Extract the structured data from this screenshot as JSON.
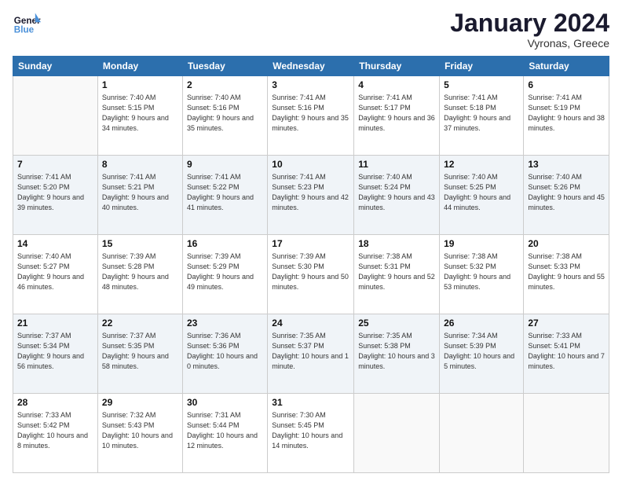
{
  "header": {
    "logo_line1": "General",
    "logo_line2": "Blue",
    "month": "January 2024",
    "location": "Vyronas, Greece"
  },
  "weekdays": [
    "Sunday",
    "Monday",
    "Tuesday",
    "Wednesday",
    "Thursday",
    "Friday",
    "Saturday"
  ],
  "weeks": [
    [
      {
        "day": "",
        "sunrise": "",
        "sunset": "",
        "daylight": ""
      },
      {
        "day": "1",
        "sunrise": "Sunrise: 7:40 AM",
        "sunset": "Sunset: 5:15 PM",
        "daylight": "Daylight: 9 hours and 34 minutes."
      },
      {
        "day": "2",
        "sunrise": "Sunrise: 7:40 AM",
        "sunset": "Sunset: 5:16 PM",
        "daylight": "Daylight: 9 hours and 35 minutes."
      },
      {
        "day": "3",
        "sunrise": "Sunrise: 7:41 AM",
        "sunset": "Sunset: 5:16 PM",
        "daylight": "Daylight: 9 hours and 35 minutes."
      },
      {
        "day": "4",
        "sunrise": "Sunrise: 7:41 AM",
        "sunset": "Sunset: 5:17 PM",
        "daylight": "Daylight: 9 hours and 36 minutes."
      },
      {
        "day": "5",
        "sunrise": "Sunrise: 7:41 AM",
        "sunset": "Sunset: 5:18 PM",
        "daylight": "Daylight: 9 hours and 37 minutes."
      },
      {
        "day": "6",
        "sunrise": "Sunrise: 7:41 AM",
        "sunset": "Sunset: 5:19 PM",
        "daylight": "Daylight: 9 hours and 38 minutes."
      }
    ],
    [
      {
        "day": "7",
        "sunrise": "Sunrise: 7:41 AM",
        "sunset": "Sunset: 5:20 PM",
        "daylight": "Daylight: 9 hours and 39 minutes."
      },
      {
        "day": "8",
        "sunrise": "Sunrise: 7:41 AM",
        "sunset": "Sunset: 5:21 PM",
        "daylight": "Daylight: 9 hours and 40 minutes."
      },
      {
        "day": "9",
        "sunrise": "Sunrise: 7:41 AM",
        "sunset": "Sunset: 5:22 PM",
        "daylight": "Daylight: 9 hours and 41 minutes."
      },
      {
        "day": "10",
        "sunrise": "Sunrise: 7:41 AM",
        "sunset": "Sunset: 5:23 PM",
        "daylight": "Daylight: 9 hours and 42 minutes."
      },
      {
        "day": "11",
        "sunrise": "Sunrise: 7:40 AM",
        "sunset": "Sunset: 5:24 PM",
        "daylight": "Daylight: 9 hours and 43 minutes."
      },
      {
        "day": "12",
        "sunrise": "Sunrise: 7:40 AM",
        "sunset": "Sunset: 5:25 PM",
        "daylight": "Daylight: 9 hours and 44 minutes."
      },
      {
        "day": "13",
        "sunrise": "Sunrise: 7:40 AM",
        "sunset": "Sunset: 5:26 PM",
        "daylight": "Daylight: 9 hours and 45 minutes."
      }
    ],
    [
      {
        "day": "14",
        "sunrise": "Sunrise: 7:40 AM",
        "sunset": "Sunset: 5:27 PM",
        "daylight": "Daylight: 9 hours and 46 minutes."
      },
      {
        "day": "15",
        "sunrise": "Sunrise: 7:39 AM",
        "sunset": "Sunset: 5:28 PM",
        "daylight": "Daylight: 9 hours and 48 minutes."
      },
      {
        "day": "16",
        "sunrise": "Sunrise: 7:39 AM",
        "sunset": "Sunset: 5:29 PM",
        "daylight": "Daylight: 9 hours and 49 minutes."
      },
      {
        "day": "17",
        "sunrise": "Sunrise: 7:39 AM",
        "sunset": "Sunset: 5:30 PM",
        "daylight": "Daylight: 9 hours and 50 minutes."
      },
      {
        "day": "18",
        "sunrise": "Sunrise: 7:38 AM",
        "sunset": "Sunset: 5:31 PM",
        "daylight": "Daylight: 9 hours and 52 minutes."
      },
      {
        "day": "19",
        "sunrise": "Sunrise: 7:38 AM",
        "sunset": "Sunset: 5:32 PM",
        "daylight": "Daylight: 9 hours and 53 minutes."
      },
      {
        "day": "20",
        "sunrise": "Sunrise: 7:38 AM",
        "sunset": "Sunset: 5:33 PM",
        "daylight": "Daylight: 9 hours and 55 minutes."
      }
    ],
    [
      {
        "day": "21",
        "sunrise": "Sunrise: 7:37 AM",
        "sunset": "Sunset: 5:34 PM",
        "daylight": "Daylight: 9 hours and 56 minutes."
      },
      {
        "day": "22",
        "sunrise": "Sunrise: 7:37 AM",
        "sunset": "Sunset: 5:35 PM",
        "daylight": "Daylight: 9 hours and 58 minutes."
      },
      {
        "day": "23",
        "sunrise": "Sunrise: 7:36 AM",
        "sunset": "Sunset: 5:36 PM",
        "daylight": "Daylight: 10 hours and 0 minutes."
      },
      {
        "day": "24",
        "sunrise": "Sunrise: 7:35 AM",
        "sunset": "Sunset: 5:37 PM",
        "daylight": "Daylight: 10 hours and 1 minute."
      },
      {
        "day": "25",
        "sunrise": "Sunrise: 7:35 AM",
        "sunset": "Sunset: 5:38 PM",
        "daylight": "Daylight: 10 hours and 3 minutes."
      },
      {
        "day": "26",
        "sunrise": "Sunrise: 7:34 AM",
        "sunset": "Sunset: 5:39 PM",
        "daylight": "Daylight: 10 hours and 5 minutes."
      },
      {
        "day": "27",
        "sunrise": "Sunrise: 7:33 AM",
        "sunset": "Sunset: 5:41 PM",
        "daylight": "Daylight: 10 hours and 7 minutes."
      }
    ],
    [
      {
        "day": "28",
        "sunrise": "Sunrise: 7:33 AM",
        "sunset": "Sunset: 5:42 PM",
        "daylight": "Daylight: 10 hours and 8 minutes."
      },
      {
        "day": "29",
        "sunrise": "Sunrise: 7:32 AM",
        "sunset": "Sunset: 5:43 PM",
        "daylight": "Daylight: 10 hours and 10 minutes."
      },
      {
        "day": "30",
        "sunrise": "Sunrise: 7:31 AM",
        "sunset": "Sunset: 5:44 PM",
        "daylight": "Daylight: 10 hours and 12 minutes."
      },
      {
        "day": "31",
        "sunrise": "Sunrise: 7:30 AM",
        "sunset": "Sunset: 5:45 PM",
        "daylight": "Daylight: 10 hours and 14 minutes."
      },
      {
        "day": "",
        "sunrise": "",
        "sunset": "",
        "daylight": ""
      },
      {
        "day": "",
        "sunrise": "",
        "sunset": "",
        "daylight": ""
      },
      {
        "day": "",
        "sunrise": "",
        "sunset": "",
        "daylight": ""
      }
    ]
  ]
}
